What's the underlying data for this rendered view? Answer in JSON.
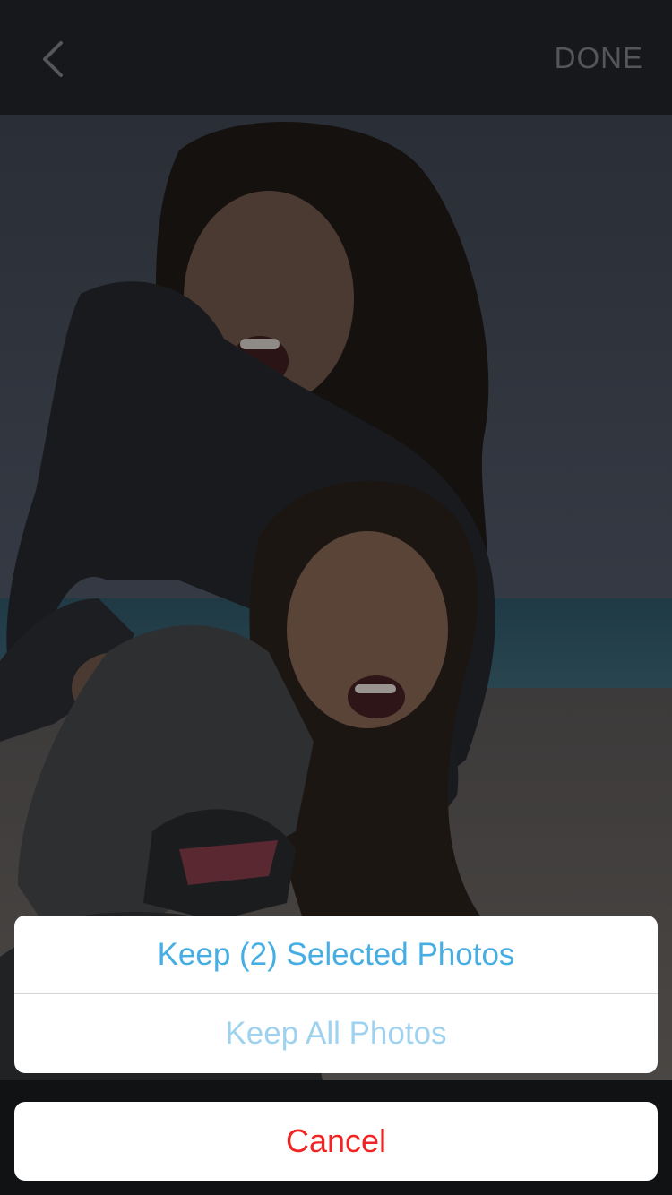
{
  "navbar": {
    "back_icon": "chevron-left-icon",
    "done_label": "DONE"
  },
  "photo": {
    "description_icon": "photo"
  },
  "action_sheet": {
    "keep_selected_label": "Keep (2) Selected Photos",
    "keep_all_label": "Keep All Photos",
    "cancel_label": "Cancel"
  },
  "colors": {
    "primary_action": "#46aee3",
    "secondary_action": "#9fd2ef",
    "destructive": "#f02424",
    "navbar": "#17181b"
  }
}
